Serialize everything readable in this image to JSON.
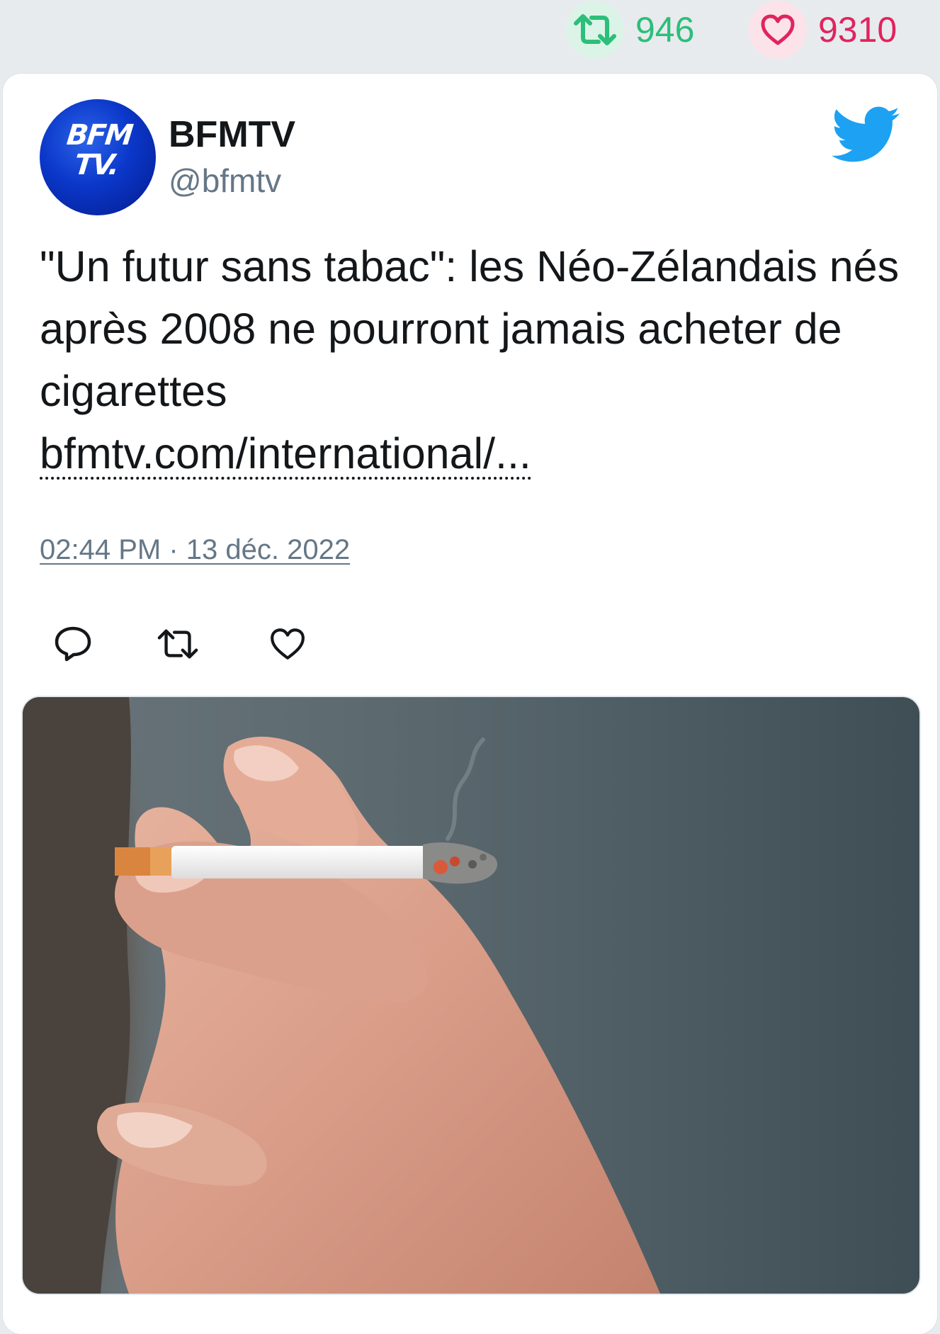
{
  "stats": {
    "retweets": "946",
    "likes": "9310"
  },
  "author": {
    "name": "BFMTV",
    "handle": "@bfmtv",
    "avatar_text_line1": "BFM",
    "avatar_text_line2": "TV."
  },
  "tweet": {
    "text": "\"Un futur sans tabac\": les Néo-Zélandais nés après 2008 ne pourront jamais acheter de cigarettes",
    "link": "bfmtv.com/international/...",
    "timestamp": "02:44 PM · 13 déc. 2022"
  },
  "icons": {
    "retweet_stat": "retweet-icon",
    "like_stat": "heart-icon",
    "brand": "twitter-bird-icon",
    "reply": "reply-icon",
    "retweet": "retweet-icon",
    "like": "heart-icon"
  },
  "colors": {
    "retweet": "#2bbf79",
    "like": "#e0245e",
    "twitter_blue": "#1da1f2",
    "secondary_text": "#657786"
  }
}
